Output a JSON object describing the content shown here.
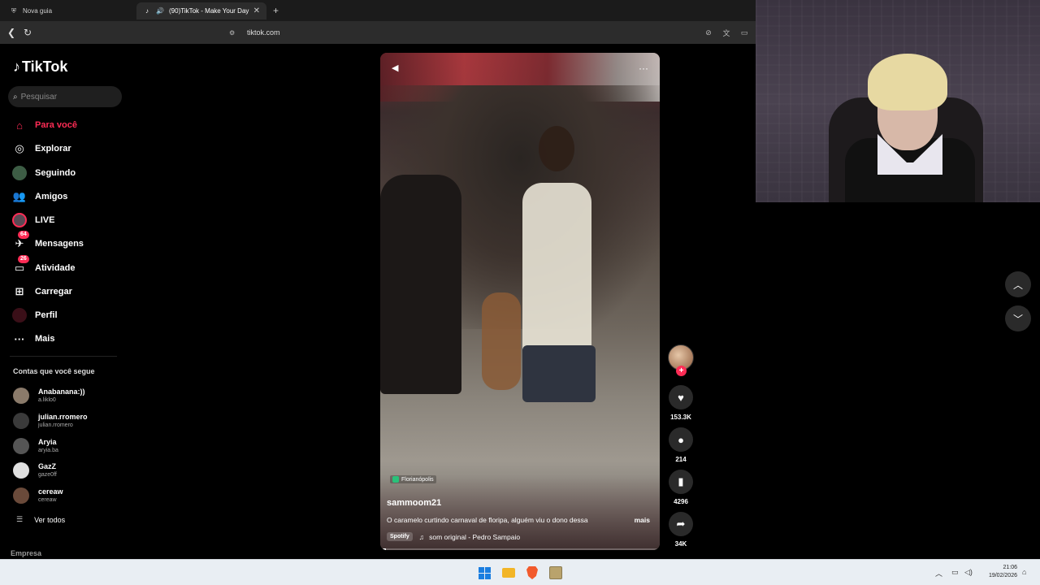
{
  "browser": {
    "tabs": [
      {
        "label": "Nova guia",
        "icon": "shield-icon"
      },
      {
        "label": "(90)TikTok - Make Your Day",
        "icon": "tiktok-icon"
      }
    ],
    "address": "tiktok.com"
  },
  "sidebar": {
    "logo": "TikTok",
    "search_placeholder": "Pesquisar",
    "items": [
      {
        "label": "Para você",
        "icon": "home-icon",
        "active": true
      },
      {
        "label": "Explorar",
        "icon": "compass-icon"
      },
      {
        "label": "Seguindo",
        "icon": "following-avatar-icon"
      },
      {
        "label": "Amigos",
        "icon": "friends-icon"
      },
      {
        "label": "LIVE",
        "icon": "live-icon"
      },
      {
        "label": "Mensagens",
        "icon": "messages-icon",
        "badge": "64"
      },
      {
        "label": "Atividade",
        "icon": "activity-icon",
        "badge": "26"
      },
      {
        "label": "Carregar",
        "icon": "upload-icon"
      },
      {
        "label": "Perfil",
        "icon": "profile-icon"
      },
      {
        "label": "Mais",
        "icon": "more-icon"
      }
    ],
    "following_title": "Contas que você segue",
    "following": [
      {
        "name": "Anabanana:))",
        "username": "a.liklo0",
        "color": "#8a7a6a"
      },
      {
        "name": "julian.rromero",
        "username": "julian.rromero",
        "color": "#3a3a3a"
      },
      {
        "name": "Aryia",
        "username": "aryia.ba",
        "color": "#555555"
      },
      {
        "name": "GazZ",
        "username": "gaze0ff",
        "color": "#e0e0e0"
      },
      {
        "name": "cereaw",
        "username": "cereaw",
        "color": "#6a4a3a"
      }
    ],
    "see_all": "Ver todos",
    "company": "Empresa"
  },
  "video": {
    "location": "Florianópolis",
    "author": "sammoom21",
    "description": "O caramelo curtindo carnaval de floripa, alguém viu o dono dessa",
    "more_label": "mais",
    "music_source": "Spotify",
    "music": "som original - Pedro Sampaio",
    "progress": 0.02
  },
  "actions": {
    "likes": "153.3K",
    "comments": "214",
    "saves": "4296",
    "shares": "34K"
  },
  "taskbar": {
    "time": "21:06",
    "date": "19/02/2026"
  },
  "colors": {
    "accent": "#fe2c55",
    "background": "#000000"
  }
}
